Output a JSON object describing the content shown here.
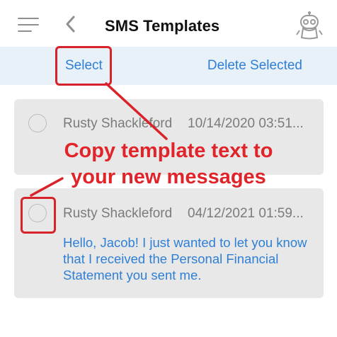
{
  "header": {
    "title": "SMS Templates",
    "menu_icon": "hamburger-menu-icon",
    "back_icon": "chevron-left-icon",
    "profile_icon": "robot-avatar-icon"
  },
  "toolbar": {
    "select_label": "Select",
    "delete_label": "Delete Selected"
  },
  "templates": [
    {
      "sender": "Rusty Shackleford",
      "date": "10/14/2020 03:51...",
      "message": ""
    },
    {
      "sender": "Rusty Shackleford",
      "date": "04/12/2021 01:59...",
      "message": "Hello, Jacob! I just wanted to let you know that I received the Personal Financial Statement you sent me."
    }
  ],
  "annotation": {
    "line1": "Copy template text to",
    "line2": "your new messages"
  },
  "colors": {
    "accent": "#2f7fd4",
    "toolbar_bg": "#e8f0f8",
    "card_bg": "#e8e8e8",
    "annotation": "#e0242a"
  }
}
